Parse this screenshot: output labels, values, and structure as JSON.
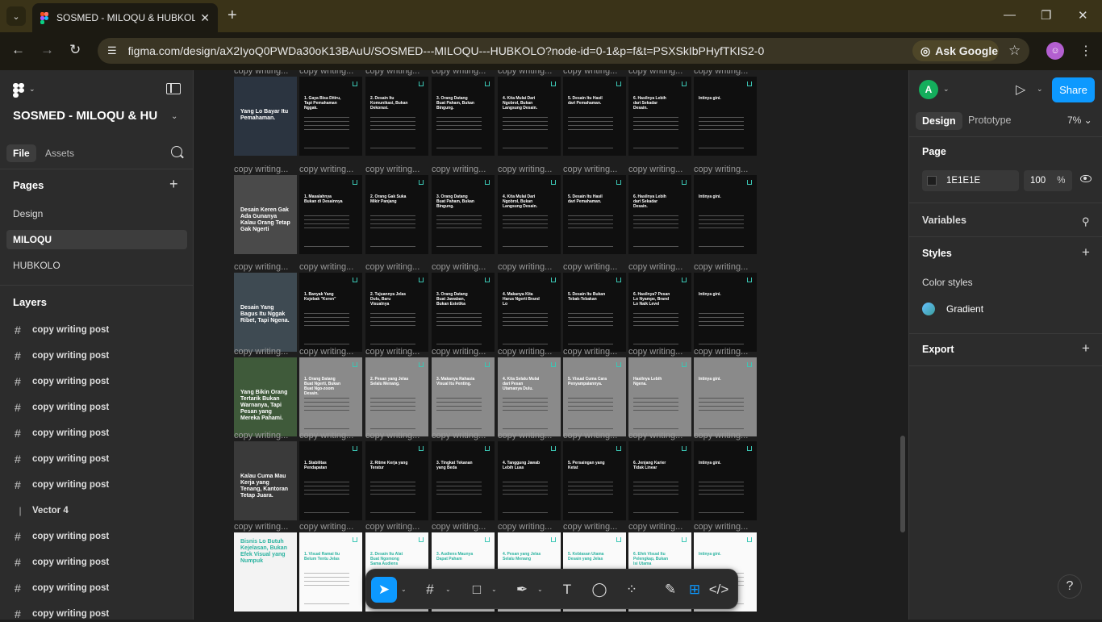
{
  "browser": {
    "tab_title": "SOSMED - MILOQU & HUBKOLO",
    "url": "figma.com/design/aX2IyoQ0PWDa30oK13BAuU/SOSMED---MILOQU---HUBKOLO?node-id=0-1&p=f&t=PSXSkIbPHyfTKIS2-0",
    "ask_google": "Ask Google"
  },
  "left_panel": {
    "project_name": "SOSMED - MILOQU & HUB...",
    "tabs": [
      "File",
      "Assets"
    ],
    "pages_title": "Pages",
    "pages": [
      "Design",
      "MILOQU",
      "HUBKOLO"
    ],
    "active_page": "MILOQU",
    "layers_title": "Layers",
    "layers": [
      {
        "name": "copy writing post",
        "kind": "frame"
      },
      {
        "name": "copy writing post",
        "kind": "frame"
      },
      {
        "name": "copy writing post",
        "kind": "frame"
      },
      {
        "name": "copy writing post",
        "kind": "frame"
      },
      {
        "name": "copy writing post",
        "kind": "frame"
      },
      {
        "name": "copy writing post",
        "kind": "frame"
      },
      {
        "name": "copy writing post",
        "kind": "frame"
      },
      {
        "name": "Vector 4",
        "kind": "vector"
      },
      {
        "name": "copy writing post",
        "kind": "frame"
      },
      {
        "name": "copy writing post",
        "kind": "frame"
      },
      {
        "name": "copy writing post",
        "kind": "frame"
      },
      {
        "name": "copy writing post",
        "kind": "frame"
      }
    ]
  },
  "canvas": {
    "frame_label": "copy writing...",
    "rows": [
      {
        "style": "dark",
        "cover": "Yang Lo Bayar Itu Pemahaman.",
        "cover_color": "#2b3440",
        "slides": [
          "1. Gaya Bisa Ditiru, Tapi Pemahaman Nggak.",
          "2. Desain Itu Komunikasi, Bukan Dekorasi.",
          "3. Orang Datang Buat Paham, Bukan Bingung.",
          "4. Kita Mulai Dari Ngobrol, Bukan Langsung Desain.",
          "5. Desain Itu Hasil dari Pemahaman.",
          "6. Hasilnya Lebih dari Sekadar Desain.",
          "Intinya gini."
        ]
      },
      {
        "style": "dark",
        "cover": "Desain Keren Gak Ada Gunanya Kalau Orang Tetap Gak Ngerti",
        "cover_color": "#4a4a4a",
        "slides": [
          "1. Masalahnya Bukan di Desainnya",
          "2. Orang Gak Suka Mikir Panjang",
          "3. Orang Datang Buat Paham, Bukan Bingung.",
          "4. Kita Mulai Dari Ngobrol, Bukan Langsung Desain.",
          "5. Desain Itu Hasil dari Pemahaman.",
          "6. Hasilnya Lebih dari Sekadar Desain.",
          "Intinya gini."
        ]
      },
      {
        "style": "dark",
        "cover": "Desain Yang Bagus Itu Nggak Ribet, Tapi Ngena.",
        "cover_color": "#3e4a52",
        "slides": [
          "1. Banyak Yang Kejebak \"Keren\"",
          "2. Tujuannya Jelas Dulu, Baru Visualnya",
          "3. Orang Datang Buat Jawaban, Bukan Estetika",
          "4. Makanya Kita Harus Ngerti Brand Lo",
          "5. Desain Itu Bukan Tebak-Tebakan",
          "6. Hasilnya? Pesan Lo Nyampe, Brand Lo Naik Level",
          "Intinya gini."
        ]
      },
      {
        "style": "gray",
        "cover": "Yang Bikin Orang Tertarik Bukan Warnanya, Tapi Pesan yang Mereka Pahami.",
        "cover_color": "#3f5a3a",
        "slides": [
          "1. Orang Datang Buat Ngerti, Bukan Buat Ngo-zoom Desain.",
          "2. Pesan yang Jelas Selalu Menang.",
          "3. Makanya Rahasia Visual Itu Penting.",
          "4. Kita Selalu Mulai dari Pesan Utamanya Dulu.",
          "5. Visual Cuma Cara Penyampaiannya.",
          "Hasilnya Lebih Ngena.",
          "Intinya gini."
        ]
      },
      {
        "style": "dark",
        "cover": "Kalau Cuma Mau Kerja yang Tenang, Kantoran Tetap Juara.",
        "cover_color": "#3a3a3a",
        "slides": [
          "1. Stabilitas Pendapatan",
          "2. Ritme Kerja yang Teratur",
          "3. Tingkat Tekanan yang Beda",
          "4. Tanggung Jawab Lebih Luas",
          "5. Persaingan yang Ketat",
          "6. Jenjang Karier Tidak Linear",
          "Intinya gini."
        ]
      },
      {
        "style": "white",
        "cover": "Bisnis Lo Butuh Kejelasan, Bukan Efek Visual yang Numpuk",
        "cover_color": "#f3f3f3",
        "slides": [
          "1. Visual Ramai Itu Belum Tentu Jelas",
          "2. Desain Itu Alat Buat Ngomong Sama Audiens",
          "3. Audiens Maunya Dapat Paham",
          "4. Pesan yang Jelas Selalu Menang",
          "5. Kebiasan Utama Desain yang Jelas",
          "6. Efek Visual Itu Pelengkap, Bukan Isi Utama",
          "Intinya gini."
        ]
      }
    ]
  },
  "right_panel": {
    "avatar_letter": "A",
    "share_label": "Share",
    "tabs": [
      "Design",
      "Prototype"
    ],
    "zoom": "7%",
    "page_title": "Page",
    "page_color": "1E1E1E",
    "page_opacity": "100",
    "opacity_unit": "%",
    "variables": "Variables",
    "styles": "Styles",
    "color_styles": "Color styles",
    "gradient": "Gradient",
    "export": "Export"
  },
  "colors": {
    "accent": "#0d99ff",
    "frame_accent": "#3bc7b5",
    "canvas_bg": "#1e1e1e"
  },
  "icons": [
    "figma-logo-icon",
    "panel-toggle-icon",
    "search-icon",
    "plus-icon",
    "frame-hash-icon",
    "vector-icon",
    "move-tool-icon",
    "frame-tool-icon",
    "shape-tool-icon",
    "pen-tool-icon",
    "text-tool-icon",
    "comment-tool-icon",
    "actions-icon",
    "draw-icon",
    "dev-mode-icon",
    "code-icon",
    "play-icon",
    "eye-icon",
    "variables-icon",
    "help-icon"
  ]
}
